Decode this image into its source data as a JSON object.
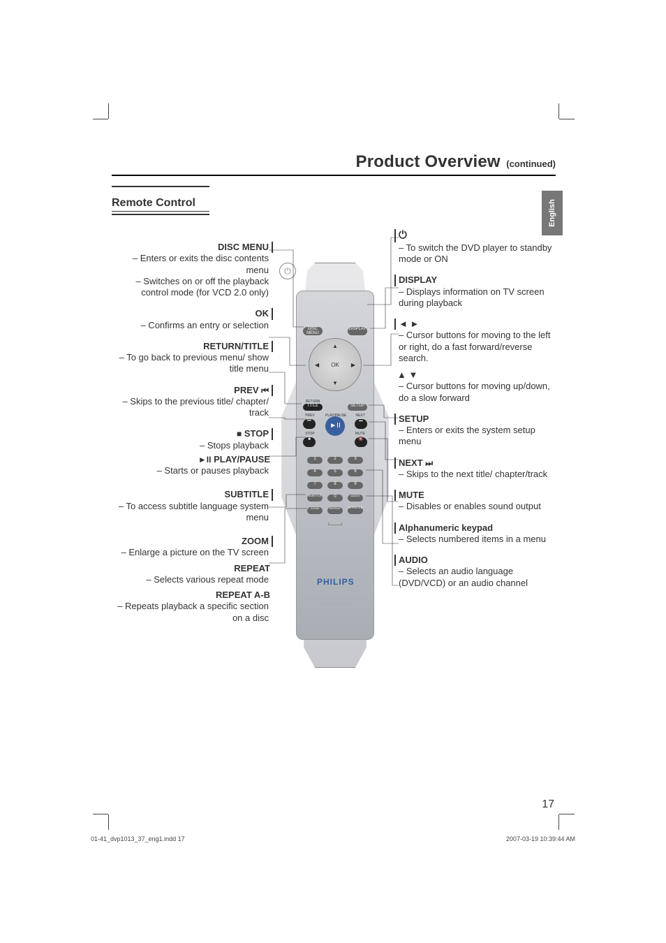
{
  "header": {
    "title": "Product Overview",
    "continued": "(continued)",
    "language_tab": "English",
    "section": "Remote Control"
  },
  "left_entries": {
    "disc_menu": {
      "label": "DISC MENU",
      "desc1": "– Enters or exits the disc contents menu",
      "desc2": "– Switches on or off the playback control mode (for VCD 2.0 only)"
    },
    "ok": {
      "label": "OK",
      "desc1": "– Confirms an entry or selection"
    },
    "return_title": {
      "label": "RETURN/TITLE",
      "desc1": "– To go back to previous menu/ show title menu"
    },
    "prev": {
      "label": "PREV ",
      "icon": "◄◄",
      "desc1": "– Skips to the previous title/ chapter/ track"
    },
    "stop": {
      "icon": "■",
      "label": " STOP",
      "desc1": "– Stops playback"
    },
    "play_pause": {
      "icon": "►II",
      "label": " PLAY/PAUSE",
      "desc1": "– Starts or pauses playback"
    },
    "subtitle": {
      "label": "SUBTITLE",
      "desc1": "– To access subtitle language system menu"
    },
    "zoom": {
      "label": "ZOOM",
      "desc1": "– Enlarge a picture on the TV screen"
    },
    "repeat": {
      "label": "REPEAT",
      "desc1": "– Selects various repeat mode"
    },
    "repeat_ab": {
      "label": "REPEAT A-B",
      "desc1": "– Repeats playback a specific section on a disc"
    }
  },
  "right_entries": {
    "power": {
      "icon": "⏻",
      "desc1": "–   To switch the DVD player to standby mode or ON"
    },
    "display": {
      "label": "DISPLAY",
      "desc1": "–   Displays information on TV screen during playback"
    },
    "lr": {
      "icon": "◄ ►",
      "desc1": "–   Cursor buttons for moving to the left or right, do a fast forward/reverse search."
    },
    "ud": {
      "icon": "▲ ▼",
      "desc1": "–   Cursor buttons for moving up/down, do a slow forward"
    },
    "setup": {
      "label": "SETUP",
      "desc1": "–   Enters or exits the system setup menu"
    },
    "next": {
      "label": "NEXT ",
      "icon": "►►",
      "desc1": "–   Skips to the next title/ chapter/track"
    },
    "mute": {
      "label": "MUTE",
      "desc1": "–   Disables or enables sound output"
    },
    "keypad": {
      "label": "Alphanumeric keypad",
      "desc1": "–   Selects numbered items in a menu"
    },
    "audio": {
      "label": "AUDIO",
      "desc1": "–   Selects an audio language (DVD/VCD) or an audio channel"
    }
  },
  "remote": {
    "ok": "OK",
    "disc_menu": "DISC\nMENU",
    "display": "DISPLAY",
    "return": "RETURN",
    "title": "TITLE",
    "setup": "SETUP",
    "prev": "PREV",
    "playpause": "PLAY/PAUSE",
    "next": "NEXT",
    "stop": "STOP",
    "mute": "MUTE",
    "subtitle": "SUBTITLE",
    "audio": "AUDIO",
    "zoom": "ZOOM",
    "repeat": "REPEAT",
    "repeat_ab": "REPEAT A-B",
    "brand": "PHILIPS",
    "player": "DVD PLAYER",
    "power_icon": "⏻"
  },
  "footer": {
    "page": "17",
    "left": "01-41_dvp1013_37_eng1.indd   17",
    "right": "2007-03-19   10:39:44 AM"
  }
}
